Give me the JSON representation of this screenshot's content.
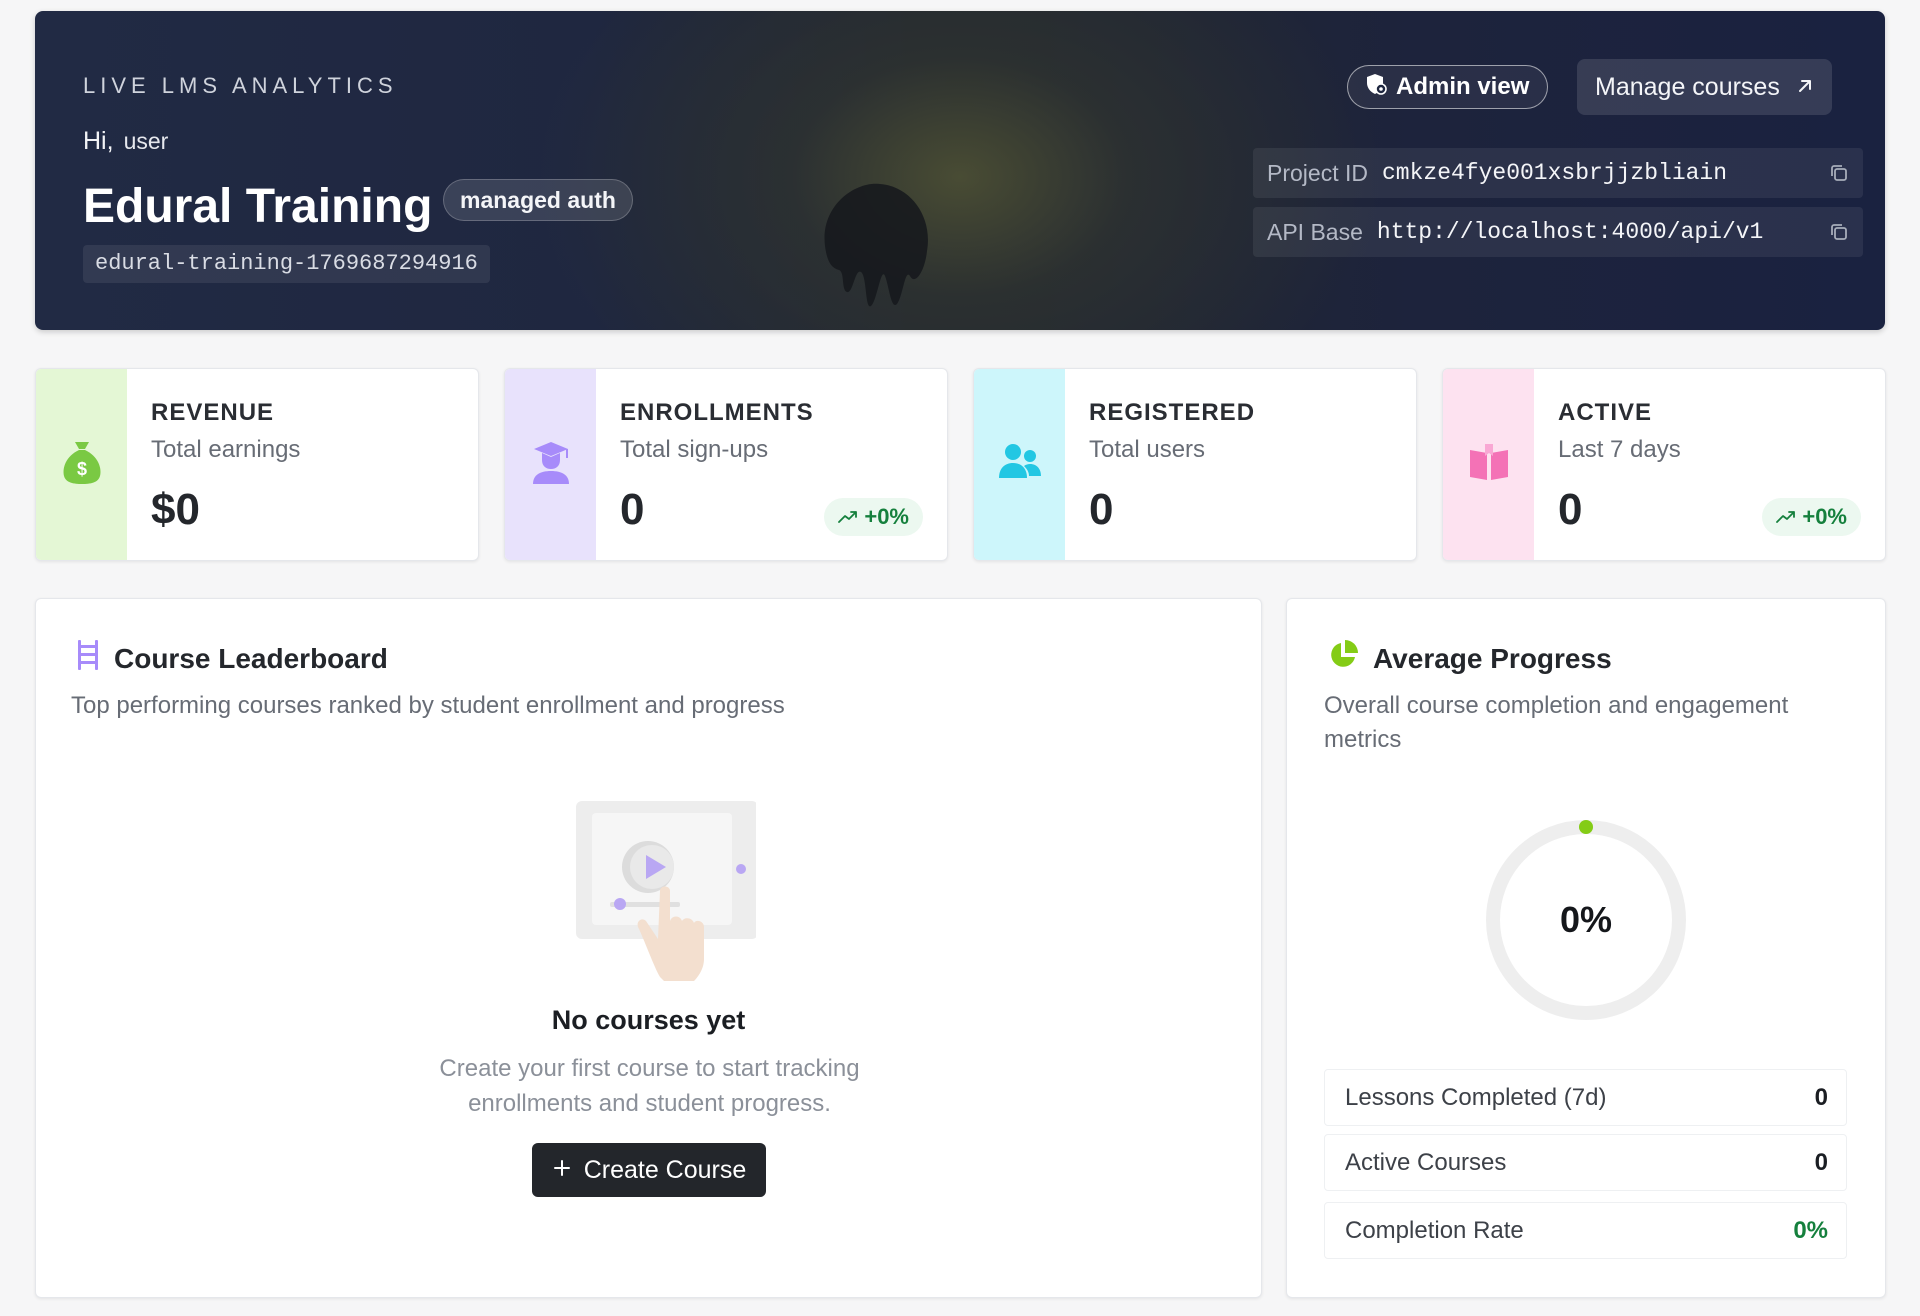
{
  "hero": {
    "kicker": "LIVE LMS ANALYTICS",
    "greeting": "Hi,",
    "user": "user",
    "title": "Edural Training",
    "auth_badge": "managed auth",
    "slug": "edural-training-1769687294916",
    "admin_button": "Admin view",
    "manage_button": "Manage courses",
    "project_id_label": "Project ID",
    "project_id": "cmkze4fye001xsbrjjzbliain",
    "api_base_label": "API Base",
    "api_base": "http://localhost:4000/api/v1"
  },
  "stats": [
    {
      "title": "REVENUE",
      "subtitle": "Total earnings",
      "value": "$0",
      "trend": "",
      "icon": "money-bag-icon",
      "band_color": "#e4f7d5",
      "icon_color": "#7ac943"
    },
    {
      "title": "ENROLLMENTS",
      "subtitle": "Total sign-ups",
      "value": "0",
      "trend": "+0%",
      "icon": "graduate-icon",
      "band_color": "#e8e2fc",
      "icon_color": "#a78bfa"
    },
    {
      "title": "REGISTERED",
      "subtitle": "Total users",
      "value": "0",
      "trend": "",
      "icon": "users-icon",
      "band_color": "#cdf6fb",
      "icon_color": "#22c7e3"
    },
    {
      "title": "ACTIVE",
      "subtitle": "Last 7 days",
      "value": "0",
      "trend": "+0%",
      "icon": "book-icon",
      "band_color": "#fde2f0",
      "icon_color": "#f472b6"
    }
  ],
  "leaderboard": {
    "title": "Course Leaderboard",
    "description": "Top performing courses ranked by student enrollment and progress",
    "empty_title": "No courses yet",
    "empty_text": "Create your first course to start tracking enrollments and student progress.",
    "create_button": "Create Course"
  },
  "progress": {
    "title": "Average Progress",
    "description": "Overall course completion and engagement metrics",
    "percent_label": "0%",
    "percent_value": 0,
    "metrics": [
      {
        "label": "Lessons Completed (7d)",
        "value": "0"
      },
      {
        "label": "Active Courses",
        "value": "0"
      },
      {
        "label": "Completion Rate",
        "value": "0%"
      }
    ]
  },
  "colors": {
    "accent_green": "#84cc16",
    "trend_green": "#15803d",
    "dark_button": "#23262b"
  }
}
